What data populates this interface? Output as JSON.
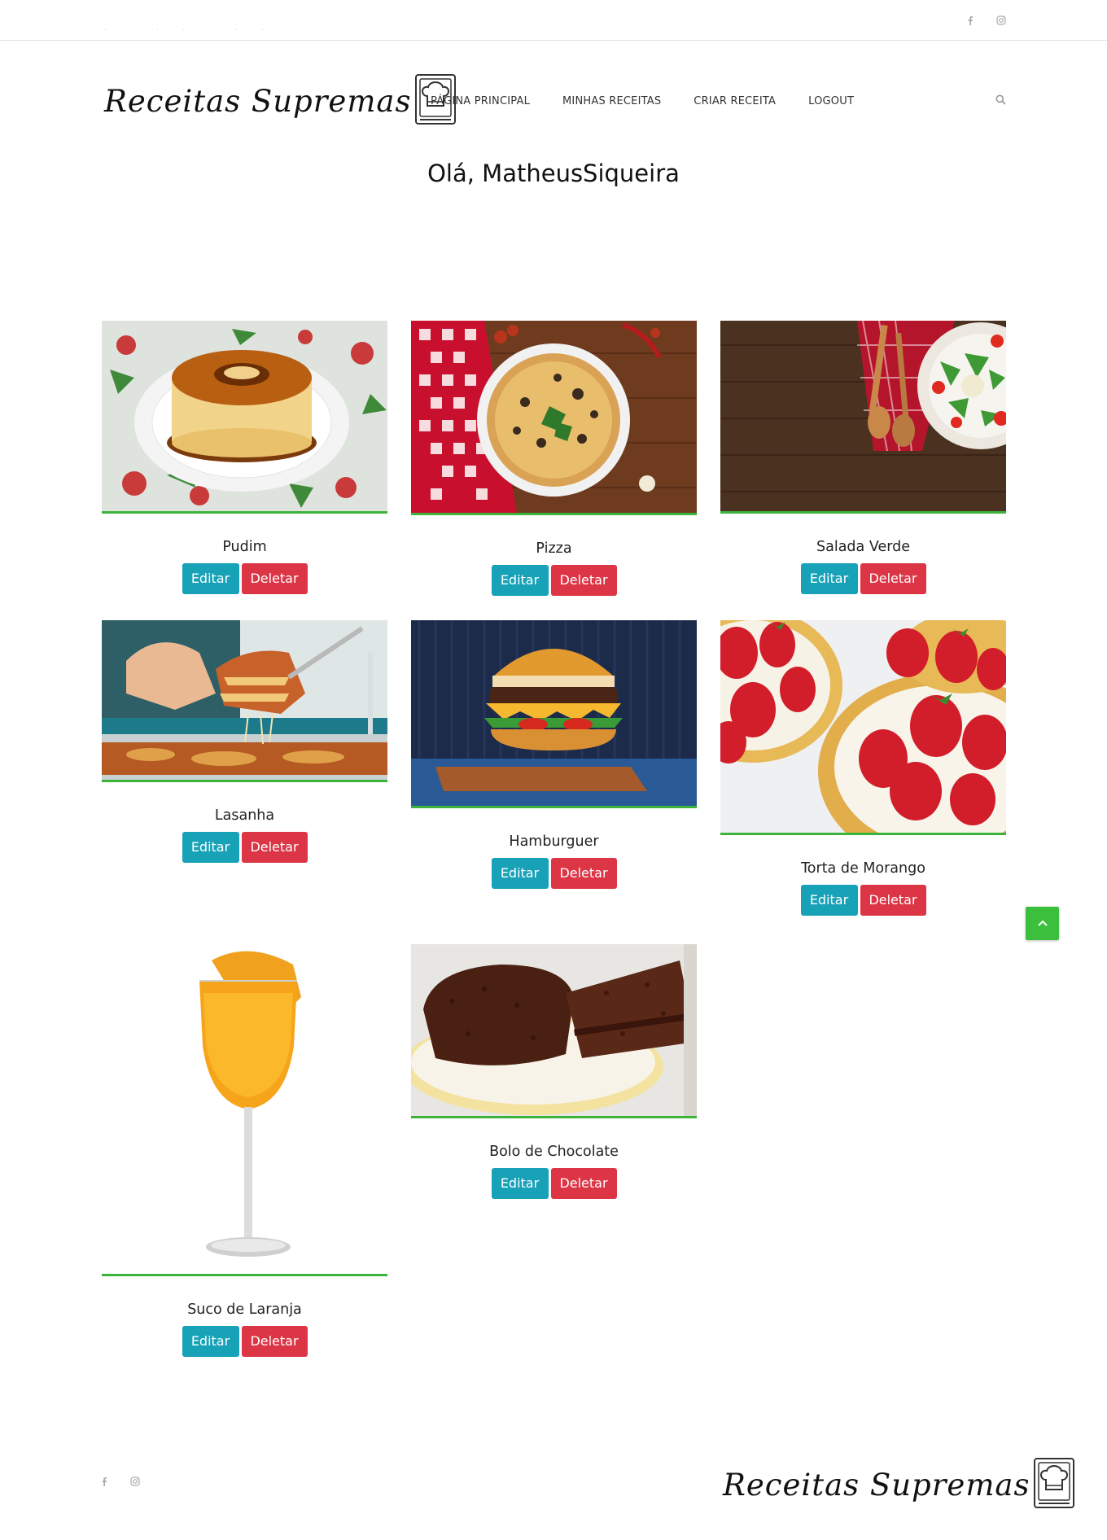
{
  "topbar": {
    "dots": ". .. .."
  },
  "header": {
    "logo_text": "Receitas Supremas",
    "nav": [
      "PÁGINA PRINCIPAL",
      "MINHAS RECEITAS",
      "CRIAR RECEITA",
      "LOGOUT"
    ]
  },
  "greeting": "Olá, MatheusSiqueira",
  "buttons": {
    "edit": "Editar",
    "delete": "Deletar"
  },
  "recipes": [
    {
      "title": "Pudim"
    },
    {
      "title": "Pizza"
    },
    {
      "title": "Salada Verde"
    },
    {
      "title": "Lasanha"
    },
    {
      "title": "Hamburguer"
    },
    {
      "title": "Torta de Morango"
    },
    {
      "title": "Suco de Laranja"
    },
    {
      "title": "Bolo de Chocolate"
    }
  ],
  "footer": {
    "logo_text": "Receitas Supremas"
  },
  "icons": {
    "social": [
      "facebook-icon",
      "instagram-icon"
    ],
    "search": "search-icon",
    "back_to_top": "chevron-up-icon",
    "logo": "chef-book-icon"
  },
  "colors": {
    "edit_button": "#17a2b8",
    "delete_button": "#dc3545",
    "accent_green": "#3cb43c"
  }
}
